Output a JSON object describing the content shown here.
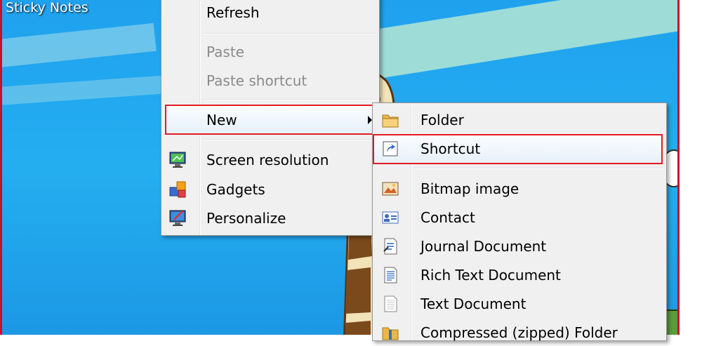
{
  "desktop": {
    "title": "Sticky Notes"
  },
  "context_menu": {
    "items": [
      {
        "label": "Refresh",
        "enabled": true
      },
      {
        "label": "Paste",
        "enabled": false
      },
      {
        "label": "Paste shortcut",
        "enabled": false
      },
      {
        "label": "New",
        "enabled": true,
        "has_submenu": true,
        "highlighted": true
      },
      {
        "label": "Screen resolution",
        "enabled": true,
        "icon": "screen-resolution-icon"
      },
      {
        "label": "Gadgets",
        "enabled": true,
        "icon": "gadgets-icon"
      },
      {
        "label": "Personalize",
        "enabled": true,
        "icon": "personalize-icon"
      }
    ]
  },
  "new_submenu": {
    "items": [
      {
        "label": "Folder",
        "icon": "folder-icon"
      },
      {
        "label": "Shortcut",
        "icon": "shortcut-icon",
        "highlighted": true
      },
      {
        "label": "Bitmap image",
        "icon": "bitmap-image-icon"
      },
      {
        "label": "Contact",
        "icon": "contact-icon"
      },
      {
        "label": "Journal Document",
        "icon": "journal-document-icon"
      },
      {
        "label": "Rich Text Document",
        "icon": "rich-text-document-icon"
      },
      {
        "label": "Text Document",
        "icon": "text-document-icon"
      },
      {
        "label": "Compressed (zipped) Folder",
        "icon": "zipped-folder-icon"
      }
    ]
  },
  "colors": {
    "highlight_border": "#e41b23",
    "desktop_blue": "#1fa1ee"
  }
}
